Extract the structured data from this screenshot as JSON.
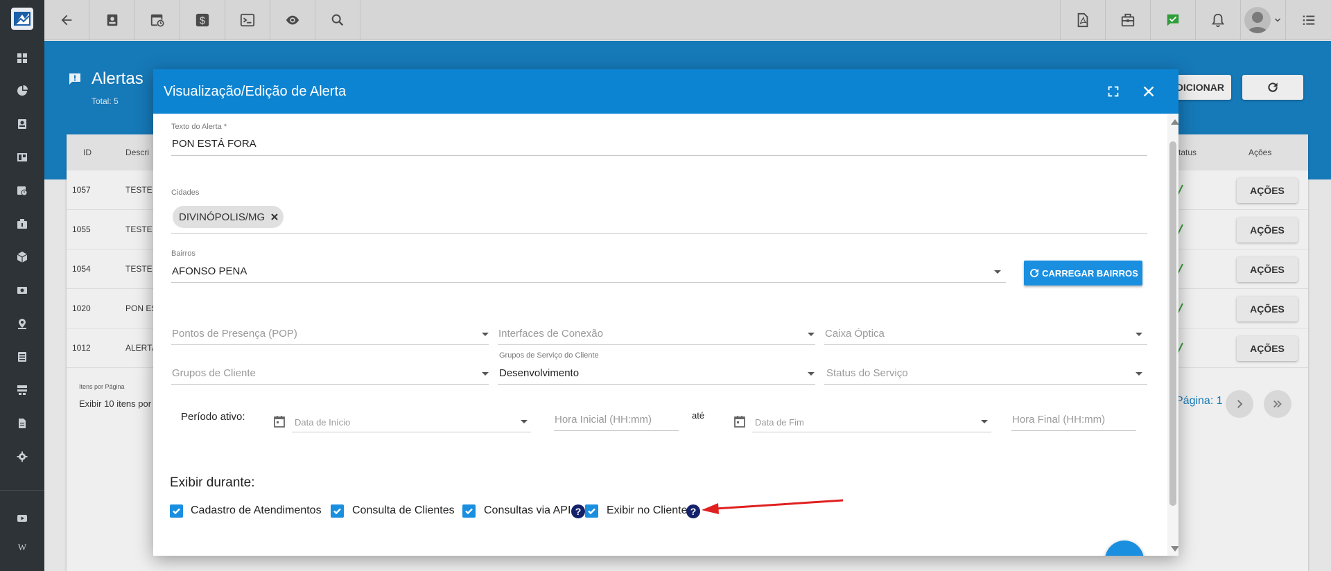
{
  "colors": {
    "sidebar": "#2e3338",
    "toolbar": "#d6d6d6",
    "page_header": "#1679b8",
    "modal_header": "#0d84d2",
    "accent": "#1a8fe0",
    "help_icon": "#14216b",
    "status_ok": "#3a9d3a",
    "annotation_arrow": "#e02020"
  },
  "sidebar": {
    "logo_icon": "app-logo-icon",
    "items": [
      "dashboard-icon",
      "pie-chart-icon",
      "contact-card-icon",
      "board-icon",
      "history-icon",
      "tools-icon",
      "package-icon",
      "money-icon",
      "map-pin-icon",
      "list-icon",
      "network-icon",
      "document-icon",
      "gear-icon"
    ],
    "bottom_items": [
      "video-icon"
    ],
    "bottom_letter": "W"
  },
  "toolbar": {
    "left_icons": [
      "arrow-left-icon",
      "contact-icon",
      "history-calendar-icon",
      "dollar-icon",
      "terminal-icon",
      "eye-icon",
      "search-icon"
    ],
    "right_icons": [
      "pdf-icon",
      "toolbox-icon",
      "chat-check-icon",
      "bell-icon",
      "avatar",
      "menu-list-icon"
    ]
  },
  "page": {
    "title": "Alertas",
    "total": "Total: 5",
    "add_label": "ADICIONAR",
    "table": {
      "headers": {
        "id": "ID",
        "description": "Descri",
        "status": "tatus",
        "actions": "Ações"
      },
      "rows": [
        {
          "id": "1057",
          "desc": "TESTE"
        },
        {
          "id": "1055",
          "desc": "TESTE"
        },
        {
          "id": "1054",
          "desc": "TESTE"
        },
        {
          "id": "1020",
          "desc": "PON ES"
        },
        {
          "id": "1012",
          "desc": "ALERT/"
        }
      ],
      "actions_label": "AÇÕES"
    },
    "items_per_page_label": "Itens por Página",
    "items_per_page_value": "Exibir 10 itens por",
    "page_label": "Página: 1"
  },
  "modal": {
    "title": "Visualização/Edição de Alerta",
    "alert_text_label": "Texto do Alerta *",
    "alert_text_value": "PON ESTÁ FORA",
    "cities_label": "Cidades",
    "city_chip": "DIVINÓPOLIS/MG",
    "neighborhood_label": "Bairros",
    "neighborhood_value": "AFONSO PENA",
    "load_button": "CARREGAR BAIRROS",
    "pop_placeholder": "Pontos de Presença (POP)",
    "interfaces_placeholder": "Interfaces de Conexão",
    "caixa_placeholder": "Caixa Óptica",
    "client_groups_placeholder": "Grupos de Cliente",
    "service_groups_label": "Grupos de Serviço do Cliente",
    "service_groups_value": "Desenvolvimento",
    "service_status_placeholder": "Status do Serviço",
    "period_label": "Período ativo:",
    "start_date_placeholder": "Data de Início",
    "start_time_placeholder": "Hora Inicial (HH:mm)",
    "until_label": "até",
    "end_date_placeholder": "Data de Fim",
    "end_time_placeholder": "Hora Final (HH:mm)",
    "display_title": "Exibir durante:",
    "checkboxes": [
      {
        "label": "Cadastro de Atendimentos",
        "checked": true
      },
      {
        "label": "Consulta de Clientes",
        "checked": true
      },
      {
        "label": "Consultas via API",
        "checked": true
      },
      {
        "label": "Exibir no Cliente",
        "checked": true
      }
    ],
    "help_glyph": "?"
  }
}
